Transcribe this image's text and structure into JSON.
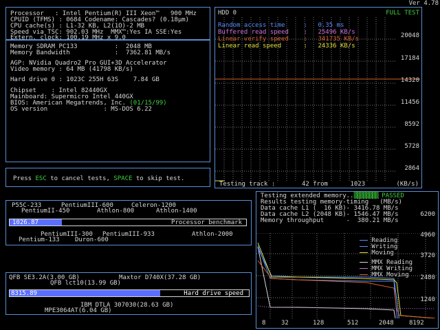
{
  "version": "Ver 4.78",
  "sysinfo": {
    "lines": [
      "Processor   : Intel Pentium(R) III Xeon™   900 MHz",
      "CPUID (TFMS) : 0684 Codename: Cascades? (0.18µm)",
      "CPU cache(s) : L1-32 KB, L2(1O)-2 MB",
      "Speed via TSC: 902.03 MHz  MMX™:Yes IA SSE:Yes",
      "Extern. clock: 100.19 MHz x 9.0"
    ],
    "mem_lines": [
      "Memory SDRAM PC133          :  2048 MB",
      "Memory Bandwidth            :  7362.81 MB/s",
      "",
      "AGP: NVidia Quadro2 Pro GUI+3D Accelerator",
      "Video memory : 64 MB (41798 KB/s)",
      "",
      "Hard drive 0 : 1023C 255H 63S    7.84 GB",
      "",
      "Chipset    : Intel 82440GX",
      "Mainboard: Supermicro Intel 440GX",
      "BIOS: American Megatrends, Inc. ",
      "OS version               : MS-DOS 6.22"
    ],
    "bios_date": "(01/15/99)"
  },
  "hint": {
    "press": "Press ",
    "esc": "ESC",
    "mid": " to cancel tests, ",
    "space": "SPACE",
    "end": " to skip test."
  },
  "hdd": {
    "title": "HDD 0",
    "full_test": "FULL TEST",
    "stats": [
      {
        "label": "Random access time     :",
        "value": "0.35 ms",
        "color": "#5a8fff"
      },
      {
        "label": "Buffered read speed    :",
        "value": "25496 KB/s",
        "color": "#d070e0"
      },
      {
        "label": "Linear verify speed    :",
        "value": "341735 KB/s",
        "color": "#d86030"
      },
      {
        "label": "Linear read speed      :",
        "value": "24336 KB/s",
        "color": "#e0e040"
      }
    ],
    "y_ticks": [
      "20048",
      "17184",
      "14320",
      "11456",
      "8592",
      "5728",
      "2864"
    ],
    "footer_left": "Testing track :",
    "footer_mid": "42 from      1023",
    "footer_right": "(KB/s)"
  },
  "memtest": {
    "line1": "Testing extended memory..",
    "passed": "PASSED",
    "line2": "Results testing memory-timing   (MB/s)",
    "line3": "Data cache L1 (  16 KB)- 3416.78 MB/s",
    "line4": "Data cache L2 (2048 KB)- 1546.47 MB/s",
    "line5": "Memory throughput      -  380.21 MB/s",
    "y_top": "6200",
    "y_ticks": [
      "4960",
      "3720",
      "2480",
      "1240"
    ],
    "x_ticks": [
      "8",
      "32",
      "128",
      "512",
      "2048",
      "8192"
    ],
    "legend": [
      {
        "label": "Reading",
        "color": "#5a8fff"
      },
      {
        "label": "Writing",
        "color": "#5a8fff"
      },
      {
        "label": "Moving",
        "color": "#e0e040"
      },
      {
        "label": "MMX Reading",
        "color": "#d8d8d8"
      },
      {
        "label": "MMX Writing",
        "color": "#d070e0"
      },
      {
        "label": "MMX Moving",
        "color": "#d86030"
      }
    ]
  },
  "cpubench": {
    "value": "1026.87",
    "bar_label": "Processor benchmark",
    "fill_fraction": 0.22,
    "top_labels": [
      "P55C-233",
      "PentiumII-450",
      "PentiumIII-600",
      "Athlon-800",
      "Celeron-1200",
      "Athlon-1400"
    ],
    "bottom_labels": [
      "Pentium-133",
      "PentiumIII-300",
      "Duron-600",
      "PentiumIII-933",
      "Athlon-2000"
    ]
  },
  "hddbench": {
    "value": "8315.89",
    "bar_label": "Hard drive speed",
    "fill_fraction": 0.63,
    "top_labels": [
      "QFB SE3.2A(3.00 GB)",
      "QFB lct10(13.99 GB)",
      "Maxtor D740X(37.28 GB)"
    ],
    "bottom_labels": [
      "IBM DTLA 307030(28.63 GB)",
      "MPE3064AT(6.04 GB)"
    ]
  },
  "colors": {
    "border": "#5a8fd6",
    "accent_green": "#40d040",
    "bar_blue": "#5a6fff"
  }
}
